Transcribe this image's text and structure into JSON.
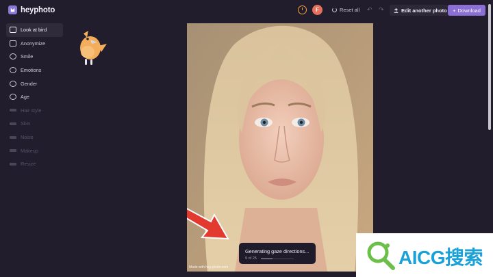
{
  "brand": {
    "name": "heyphoto",
    "accent": "#8b6fd4"
  },
  "header": {
    "avatar_initial": "F",
    "reset_label": "Reset all",
    "edit_label": "Edit another photo",
    "download_label": "Download",
    "undo_symbol": "↶",
    "redo_symbol": "↷"
  },
  "sidebar": {
    "items": [
      {
        "label": "Look at bird",
        "state": "active",
        "icon": "eye-bird-icon"
      },
      {
        "label": "Anonymize",
        "state": "enabled",
        "icon": "mask-icon"
      },
      {
        "label": "Smile",
        "state": "enabled",
        "icon": "smile-icon"
      },
      {
        "label": "Emotions",
        "state": "enabled",
        "icon": "emotions-icon"
      },
      {
        "label": "Gender",
        "state": "enabled",
        "icon": "gender-icon"
      },
      {
        "label": "Age",
        "state": "enabled",
        "icon": "age-icon"
      },
      {
        "label": "Hair style",
        "state": "disabled",
        "icon": "hair-icon"
      },
      {
        "label": "Skin",
        "state": "disabled",
        "icon": "skin-icon"
      },
      {
        "label": "Noise",
        "state": "disabled",
        "icon": "noise-icon"
      },
      {
        "label": "Makeup",
        "state": "disabled",
        "icon": "makeup-icon"
      },
      {
        "label": "Resize",
        "state": "disabled",
        "icon": "resize-icon"
      }
    ]
  },
  "photo": {
    "caption": "Made with hey-photo.com"
  },
  "progress": {
    "title": "Generating gaze directions...",
    "count": "9 of 25",
    "fraction": 0.36
  },
  "watermark": {
    "text": "AICG搜索"
  }
}
